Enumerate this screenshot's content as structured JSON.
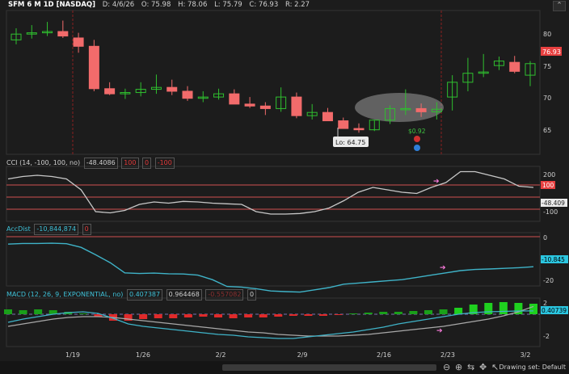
{
  "header": {
    "symbol": "SFM 6 M 1D [NASDAQ]",
    "date": "D: 4/6/26",
    "open": "O: 75.98",
    "high": "H: 78.06",
    "low": "L: 75.79",
    "close": "C: 76.93",
    "range": "R: 2.27"
  },
  "price_axis": {
    "ticks": [
      "80",
      "75",
      "70",
      "65"
    ],
    "last_price": "76.93"
  },
  "annotations": {
    "low_label": "Lo: 64.75",
    "dividend": "$0.92"
  },
  "cci": {
    "label": "CCI (14, -100, 100, no)",
    "value": "-48.4086",
    "p1": "100",
    "p2": "0",
    "p3": "-100",
    "axis": [
      "200",
      "100",
      "-48.409",
      "-100"
    ]
  },
  "accdist": {
    "label": "AccDist",
    "value": "-10,844,874",
    "p1": "0",
    "axis": [
      "0",
      "-10.845",
      "-20"
    ]
  },
  "macd": {
    "label": "MACD (12, 26, 9, EXPONENTIAL, no)",
    "value": "0.407387",
    "avg": "0.964468",
    "diff": "-0.557082",
    "p1": "0",
    "axis": [
      "2",
      "0.40739",
      "-2"
    ]
  },
  "dates": [
    "1/19",
    "1/26",
    "2/2",
    "2/9",
    "2/16",
    "2/23",
    "3/2"
  ],
  "bottom": {
    "drawing_set": "Drawing set: Default"
  },
  "colors": {
    "up": "#2fbf2f",
    "down": "#f26b6b",
    "cyan": "#3fc1d8",
    "bg": "#1c1c1c"
  },
  "chart_data": {
    "type": "candlestick",
    "x": [
      "1/13",
      "1/14",
      "1/15",
      "1/16",
      "1/20",
      "1/21",
      "1/22",
      "1/23",
      "1/26",
      "1/27",
      "1/28",
      "1/29",
      "1/30",
      "2/2",
      "2/3",
      "2/4",
      "2/5",
      "2/6",
      "2/9",
      "2/10",
      "2/11",
      "2/12",
      "2/13",
      "2/17",
      "2/18",
      "2/19",
      "2/20",
      "2/23",
      "2/24",
      "2/25",
      "2/26",
      "2/27",
      "3/2",
      "3/3"
    ],
    "open": [
      79.2,
      80.1,
      80.3,
      80.5,
      79.5,
      78.2,
      71.6,
      70.8,
      71.0,
      71.5,
      71.8,
      71.2,
      70.1,
      70.3,
      70.8,
      69.2,
      68.9,
      68.5,
      70.3,
      67.4,
      67.9,
      66.6,
      65.4,
      65.2,
      66.7,
      68.5,
      68.5,
      68.0,
      70.3,
      72.6,
      74.0,
      75.2,
      75.7,
      73.7
    ],
    "high": [
      81.0,
      81.5,
      82.0,
      82.2,
      80.3,
      79.2,
      72.6,
      71.6,
      72.6,
      73.8,
      73.0,
      72.0,
      71.2,
      71.6,
      71.5,
      70.3,
      69.5,
      71.8,
      71.0,
      69.2,
      68.6,
      67.1,
      66.2,
      66.7,
      69.0,
      71.5,
      69.3,
      69.5,
      73.7,
      76.4,
      77.0,
      76.6,
      76.7,
      75.9
    ],
    "low": [
      78.5,
      79.4,
      79.8,
      79.5,
      77.2,
      71.2,
      70.6,
      70.0,
      70.4,
      70.8,
      70.6,
      69.7,
      69.5,
      69.9,
      69.9,
      68.6,
      67.5,
      68.0,
      67.0,
      66.8,
      66.6,
      65.6,
      64.75,
      65.0,
      66.1,
      67.5,
      67.2,
      66.8,
      68.2,
      71.2,
      73.4,
      74.5,
      74.0,
      72.0
    ],
    "close": [
      80.1,
      80.3,
      80.5,
      79.8,
      78.2,
      71.6,
      70.8,
      71.0,
      71.5,
      71.8,
      71.2,
      70.1,
      70.3,
      70.8,
      69.2,
      68.9,
      68.5,
      70.3,
      67.4,
      67.9,
      66.6,
      65.4,
      65.2,
      66.7,
      68.5,
      68.5,
      68.0,
      68.4,
      72.6,
      74.0,
      74.2,
      75.9,
      74.3,
      75.5
    ],
    "cci": [
      150,
      170,
      180,
      170,
      150,
      60,
      -120,
      -130,
      -110,
      -60,
      -40,
      -50,
      -35,
      -40,
      -50,
      -55,
      -60,
      -120,
      -140,
      -140,
      -135,
      -120,
      -90,
      -30,
      40,
      80,
      60,
      40,
      30,
      80,
      120,
      210,
      210,
      180,
      150,
      90,
      80
    ],
    "accdist": [
      -0.8,
      -0.5,
      -0.5,
      -0.4,
      -0.6,
      -2.2,
      -5.5,
      -9.0,
      -13.5,
      -13.8,
      -13.6,
      -13.9,
      -14.0,
      -14.5,
      -16.5,
      -19.5,
      -19.8,
      -20.5,
      -21.5,
      -21.8,
      -22.0,
      -21.0,
      -20.0,
      -18.5,
      -18.0,
      -17.5,
      -17.0,
      -16.5,
      -15.5,
      -14.5,
      -13.5,
      -12.5,
      -12.0,
      -11.8,
      -11.5,
      -11.2,
      -10.8
    ],
    "macd_hist": [
      0.6,
      0.5,
      0.6,
      0.5,
      0.3,
      0.1,
      -0.3,
      -0.8,
      -0.8,
      -0.6,
      -0.5,
      -0.5,
      -0.4,
      -0.3,
      -0.4,
      -0.5,
      -0.4,
      -0.4,
      -0.3,
      -0.2,
      -0.2,
      -0.2,
      -0.1,
      0.1,
      0.2,
      0.3,
      0.3,
      0.4,
      0.5,
      0.6,
      0.8,
      1.2,
      1.4,
      1.5,
      1.4,
      1.3
    ],
    "macd_line": [
      -1.0,
      -0.6,
      -0.3,
      0.0,
      0.2,
      0.3,
      0.1,
      -0.5,
      -1.2,
      -1.5,
      -1.7,
      -1.9,
      -2.1,
      -2.3,
      -2.5,
      -2.6,
      -2.8,
      -2.9,
      -3.0,
      -3.0,
      -2.8,
      -2.6,
      -2.4,
      -2.2,
      -1.9,
      -1.6,
      -1.2,
      -0.9,
      -0.6,
      -0.3,
      0.0,
      0.2,
      0.3,
      0.35,
      0.4,
      0.407
    ],
    "macd_avg": [
      -1.5,
      -1.2,
      -0.9,
      -0.6,
      -0.4,
      -0.3,
      -0.3,
      -0.4,
      -0.6,
      -0.8,
      -1.0,
      -1.2,
      -1.4,
      -1.6,
      -1.8,
      -2.0,
      -2.2,
      -2.3,
      -2.5,
      -2.6,
      -2.7,
      -2.7,
      -2.7,
      -2.6,
      -2.5,
      -2.3,
      -2.1,
      -1.9,
      -1.7,
      -1.5,
      -1.2,
      -0.9,
      -0.6,
      -0.2,
      0.3,
      0.96
    ]
  }
}
